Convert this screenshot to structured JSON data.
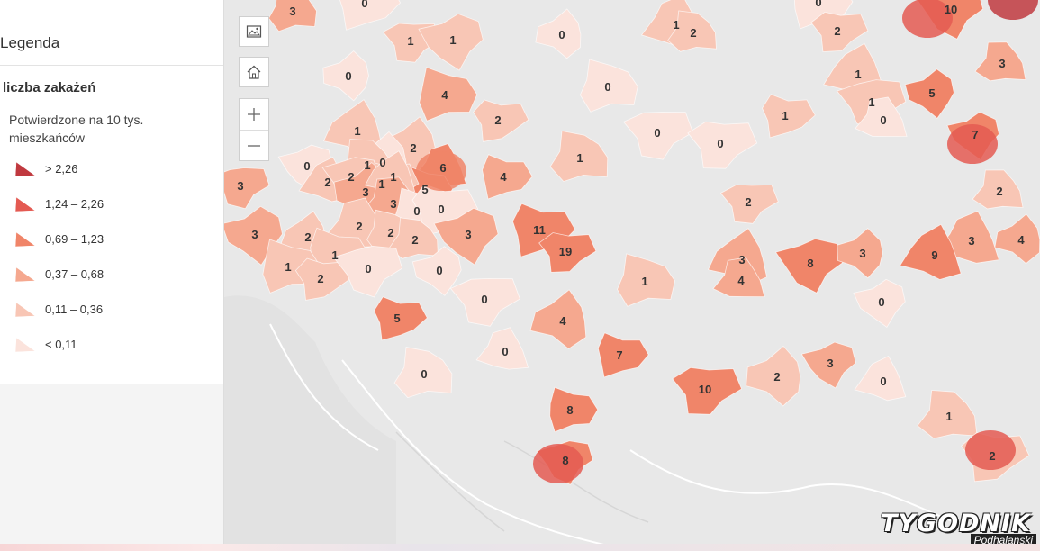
{
  "legend": {
    "title": "Legenda",
    "layer_name": "liczba zakażeń",
    "description": "Potwierdzone na 10 tys. mieszkańców",
    "classes": [
      {
        "label": "> 2,26",
        "color": "#c0393f"
      },
      {
        "label": "1,24 – 2,26",
        "color": "#e45a52"
      },
      {
        "label": "0,69 – 1,23",
        "color": "#f08569"
      },
      {
        "label": "0,37 – 0,68",
        "color": "#f5a88f"
      },
      {
        "label": "0,11 – 0,36",
        "color": "#f8c6b5"
      },
      {
        "label": "< 0,11",
        "color": "#fbe3dc"
      }
    ]
  },
  "map_controls": {
    "basemap_icon": "basemap-gallery-icon",
    "home_icon": "home-icon",
    "zoom_in_icon": "plus-icon",
    "zoom_out_icon": "minus-icon"
  },
  "map": {
    "values": [
      "3",
      "0",
      "1",
      "1",
      "0",
      "1",
      "2",
      "0",
      "2",
      "10",
      "0",
      "1",
      "3",
      "4",
      "2",
      "1",
      "5",
      "1",
      "0",
      "0",
      "1",
      "0",
      "7",
      "2",
      "6",
      "1",
      "4",
      "0",
      "0",
      "0",
      "2",
      "1",
      "5",
      "1",
      "2",
      "3",
      "1",
      "3",
      "0",
      "0",
      "3",
      "3",
      "2",
      "2",
      "2",
      "11",
      "2",
      "3",
      "4",
      "3",
      "2",
      "1",
      "19",
      "8",
      "3",
      "9",
      "2",
      "1",
      "2",
      "0",
      "0",
      "3",
      "4",
      "1",
      "5",
      "0",
      "0",
      "4",
      "0",
      "0",
      "7",
      "10",
      "3",
      "2",
      "0",
      "1",
      "8",
      "2",
      "8"
    ]
  },
  "watermark": {
    "main": "TYGODNIK",
    "sub": "Podhalanski"
  }
}
